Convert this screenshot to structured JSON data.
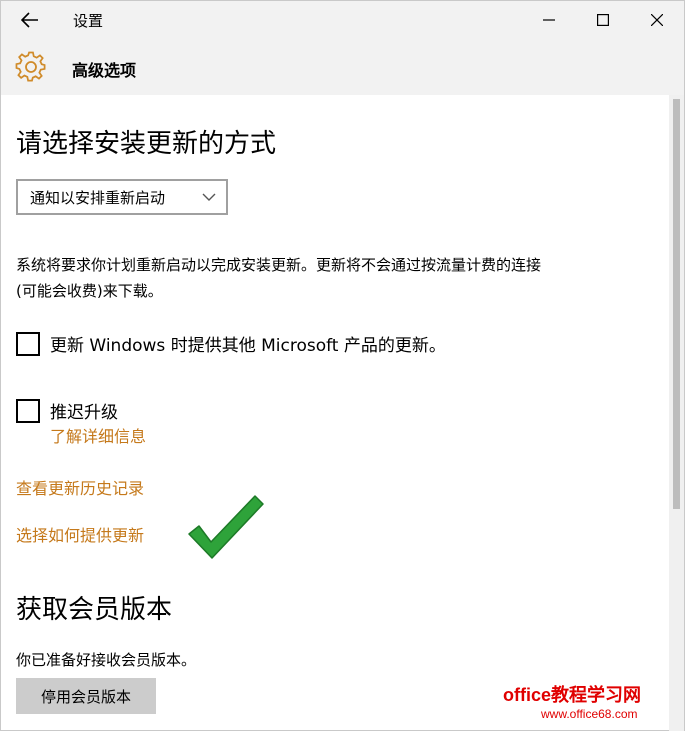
{
  "window": {
    "title": "设置",
    "back_icon": "arrow-left-icon",
    "minimize_icon": "minimize-icon",
    "maximize_icon": "maximize-icon",
    "close_icon": "close-icon"
  },
  "header": {
    "icon": "gear-icon",
    "title": "高级选项",
    "accent_color": "#d08b2a"
  },
  "install_section": {
    "heading": "请选择安装更新的方式",
    "dropdown_value": "通知以安排重新启动",
    "description": "系统将要求你计划重新启动以完成安装更新。更新将不会通过按流量计费的连接(可能会收费)来下载。"
  },
  "options": {
    "update_other_products": {
      "label": "更新 Windows 时提供其他 Microsoft 产品的更新。",
      "checked": false
    },
    "defer_upgrades": {
      "label": "推迟升级",
      "checked": false,
      "learn_more": "了解详细信息"
    }
  },
  "links": {
    "view_history": "查看更新历史记录",
    "choose_delivery": "选择如何提供更新",
    "link_color": "#c5791b"
  },
  "insider_section": {
    "heading": "获取会员版本",
    "status": "你已准备好接收会员版本。",
    "button_label": "停用会员版本"
  },
  "overlay": {
    "check_icon": "green-checkmark-icon",
    "check_color": "#2ea33a"
  },
  "watermark": {
    "main": "office教程学习网",
    "url": "www.office68.com"
  }
}
